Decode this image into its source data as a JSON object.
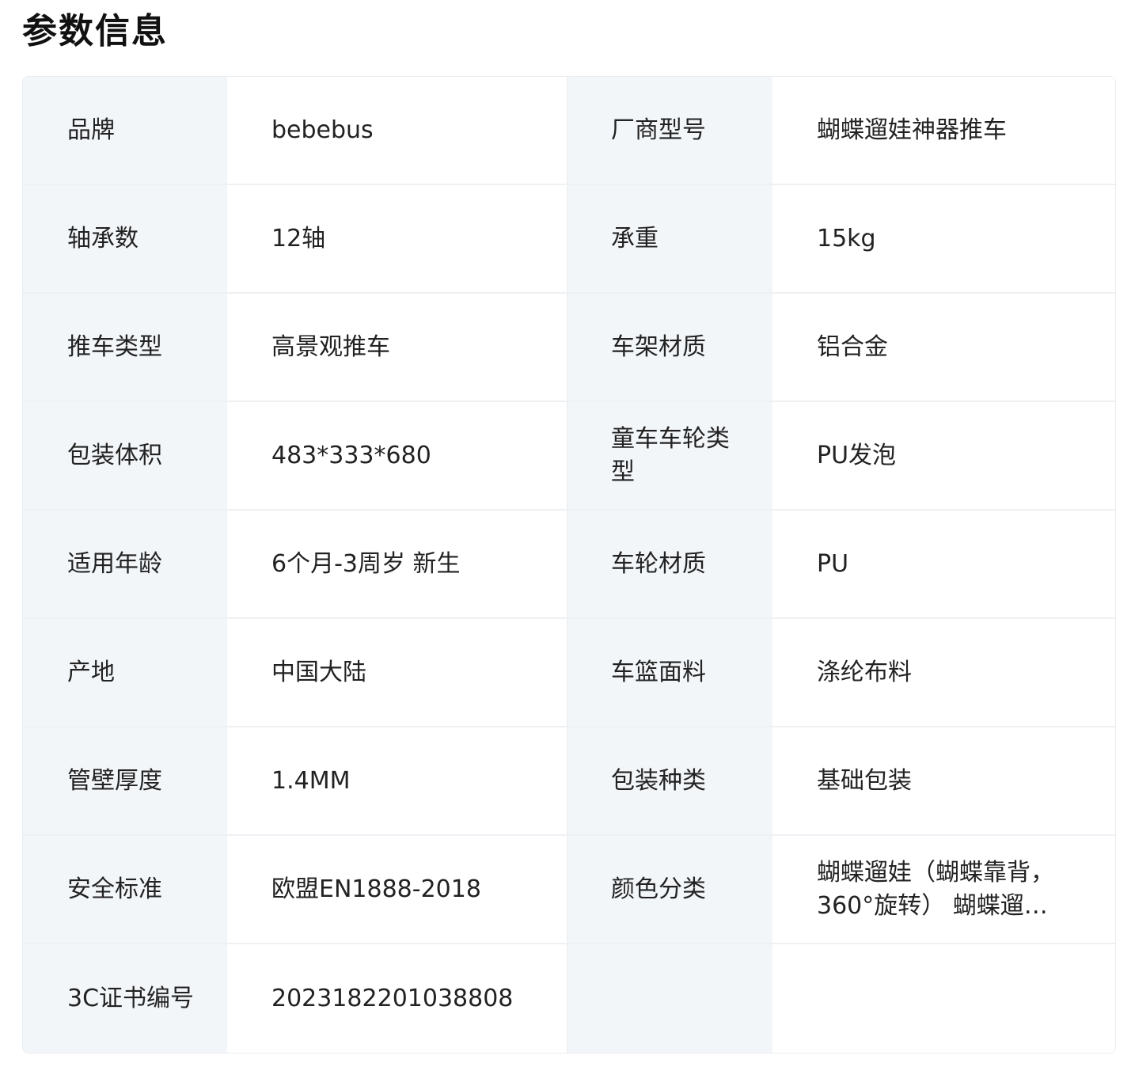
{
  "section": {
    "title": "参数信息"
  },
  "params": [
    {
      "label_left": "品牌",
      "value_left": "bebebus",
      "label_right": "厂商型号",
      "value_right": "蝴蝶遛娃神器推车"
    },
    {
      "label_left": "轴承数",
      "value_left": "12轴",
      "label_right": "承重",
      "value_right": "15kg"
    },
    {
      "label_left": "推车类型",
      "value_left": "高景观推车",
      "label_right": "车架材质",
      "value_right": "铝合金"
    },
    {
      "label_left": "包装体积",
      "value_left": "483*333*680",
      "label_right": "童车车轮类型",
      "value_right": "PU发泡"
    },
    {
      "label_left": "适用年龄",
      "value_left": "6个月-3周岁 新生",
      "label_right": "车轮材质",
      "value_right": "PU"
    },
    {
      "label_left": "产地",
      "value_left": "中国大陆",
      "label_right": "车篮面料",
      "value_right": "涤纶布料"
    },
    {
      "label_left": "管壁厚度",
      "value_left": "1.4MM",
      "label_right": "包装种类",
      "value_right": "基础包装"
    },
    {
      "label_left": "安全标准",
      "value_left": "欧盟EN1888-2018",
      "label_right": "颜色分类",
      "value_right": "蝴蝶遛娃（蝴蝶靠背，360°旋转） 蝴蝶遛…"
    },
    {
      "label_left": "3C证书编号",
      "value_left": "2023182201038808",
      "label_right": "",
      "value_right": ""
    }
  ]
}
